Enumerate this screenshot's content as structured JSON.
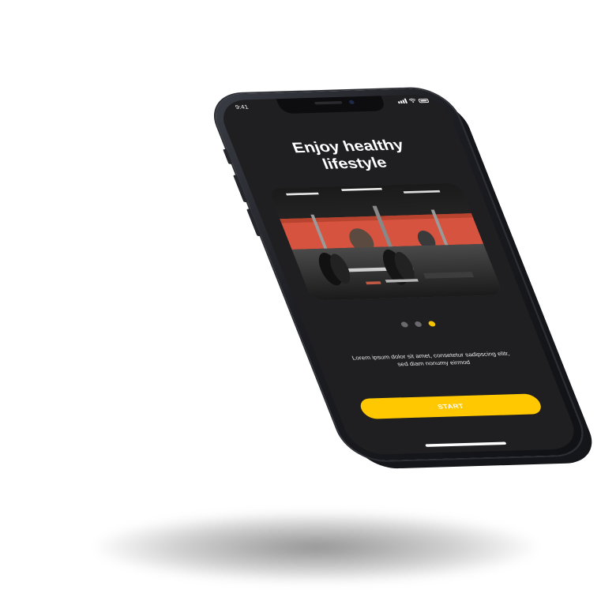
{
  "status_bar": {
    "time": "9:41",
    "icons": [
      "signal-icon",
      "wifi-icon",
      "battery-icon"
    ]
  },
  "onboarding": {
    "title": "Enjoy healthy lifestyle",
    "hero_image": "gym-barbell-photo",
    "pagination": {
      "total": 3,
      "active_index": 2
    },
    "description": "Lorem ipsum dolor sit amet, consetetur sadipscing elitr, sed diam nonumy eirmod",
    "start_label": "START"
  },
  "colors": {
    "screen_bg": "#1f1f21",
    "accent": "#ffc800",
    "dot_inactive": "#6a6a6e",
    "text": "#ffffff"
  }
}
